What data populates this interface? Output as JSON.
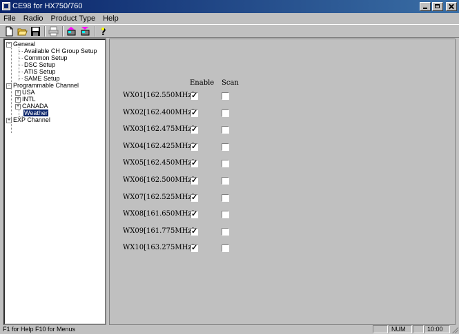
{
  "window": {
    "title": "CE98 for HX750/760"
  },
  "menu": [
    "File",
    "Radio",
    "Product Type",
    "Help"
  ],
  "tree": {
    "general": "General",
    "general_children": [
      "Available CH Group Setup",
      "Common Setup",
      "DSC Setup",
      "ATIS Setup",
      "SAME Setup"
    ],
    "programmable": "Programmable Channel",
    "programmable_children": [
      "USA",
      "INTL",
      "CANADA",
      "Weather"
    ],
    "exp": "EXP Channel"
  },
  "panel": {
    "enable_header": "Enable",
    "scan_header": "Scan",
    "channels": [
      {
        "label": "WX01[162.550MHz]",
        "enable": true,
        "scan": false
      },
      {
        "label": "WX02[162.400MHz]",
        "enable": true,
        "scan": false
      },
      {
        "label": "WX03[162.475MHz]",
        "enable": true,
        "scan": false
      },
      {
        "label": "WX04[162.425MHz]",
        "enable": true,
        "scan": false
      },
      {
        "label": "WX05[162.450MHz]",
        "enable": true,
        "scan": false
      },
      {
        "label": "WX06[162.500MHz]",
        "enable": true,
        "scan": false
      },
      {
        "label": "WX07[162.525MHz]",
        "enable": true,
        "scan": false
      },
      {
        "label": "WX08[161.650MHz]",
        "enable": true,
        "scan": false
      },
      {
        "label": "WX09[161.775MHz]",
        "enable": true,
        "scan": false
      },
      {
        "label": "WX10[163.275MHz]",
        "enable": true,
        "scan": false
      }
    ]
  },
  "status": {
    "help": "F1 for Help  F10 for Menus",
    "num": "NUM",
    "time": "10:00"
  },
  "colors": {
    "titlebar": "#0a246a",
    "face": "#c0c0c0",
    "selection": "#0a246a"
  }
}
